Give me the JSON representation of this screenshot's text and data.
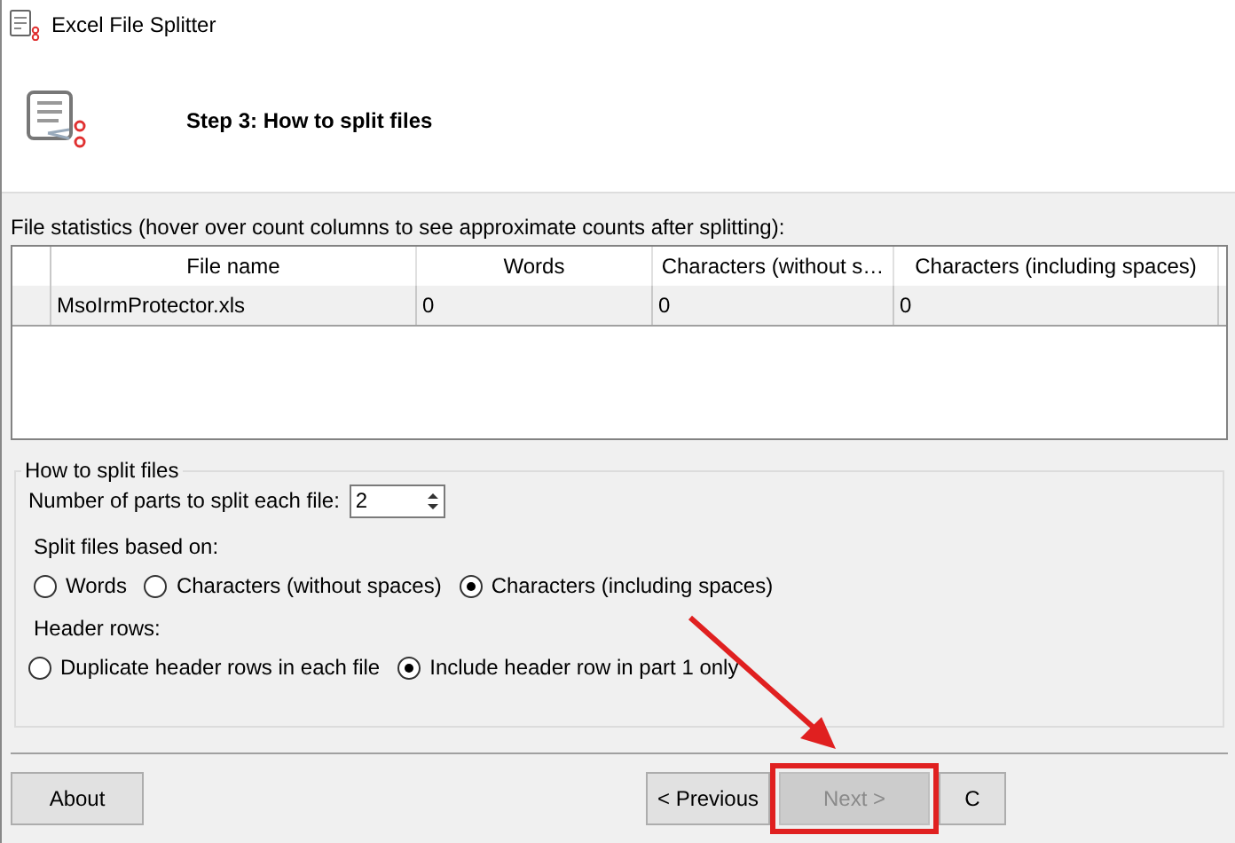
{
  "window": {
    "title": "Excel File Splitter"
  },
  "header": {
    "title": "Step 3: How to split files"
  },
  "stats_label": "File statistics (hover over count columns to see approximate counts after splitting):",
  "table": {
    "columns": [
      "File name",
      "Words",
      "Characters (without s…",
      "Characters (including spaces)"
    ],
    "rows": [
      {
        "cells": [
          "MsoIrmProtector.xls",
          "0",
          "0",
          "0"
        ]
      }
    ]
  },
  "split_group": {
    "title": "How to split files",
    "parts_label": "Number of parts to split each file:",
    "parts_value": "2",
    "based_on_label": "Split files based on:",
    "based_on": [
      {
        "label": "Words",
        "selected": false
      },
      {
        "label": "Characters (without spaces)",
        "selected": false
      },
      {
        "label": "Characters (including spaces)",
        "selected": true
      }
    ],
    "header_rows_label": "Header rows:",
    "header_rows": [
      {
        "label": "Duplicate header rows in each file",
        "selected": false
      },
      {
        "label": "Include header row in part 1 only",
        "selected": true
      }
    ]
  },
  "buttons": [
    {
      "kind": "left",
      "label": "About",
      "disabled": false
    },
    {
      "kind": "right",
      "label": "< Previous",
      "disabled": false
    },
    {
      "kind": "right",
      "label": "Next >",
      "disabled": true,
      "highlighted": true
    },
    {
      "kind": "right",
      "label": "C",
      "disabled": false
    }
  ]
}
